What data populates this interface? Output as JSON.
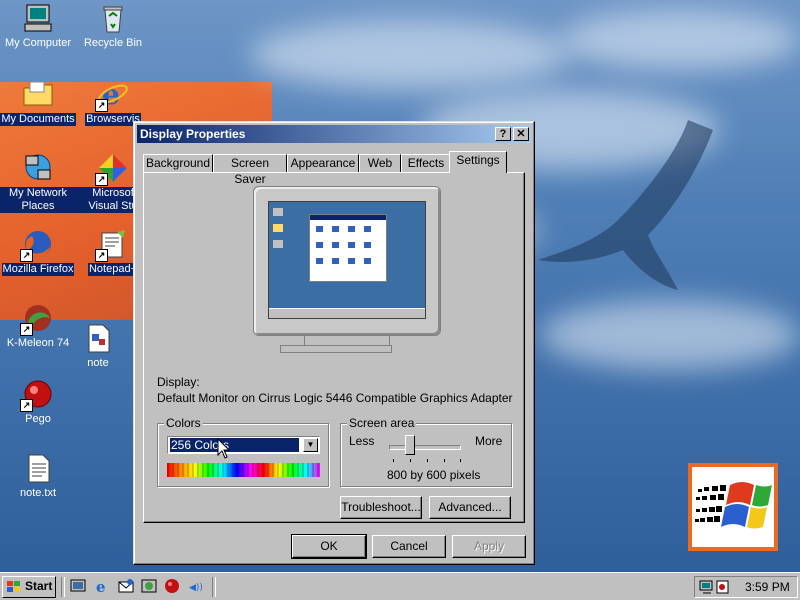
{
  "desktop": {
    "icons": [
      {
        "label": "My Computer",
        "icon": "my-computer-icon"
      },
      {
        "label": "Recycle Bin",
        "icon": "recycle-bin-icon"
      },
      {
        "label": "My Documents",
        "icon": "folder-icon"
      },
      {
        "label": "Browservis",
        "icon": "internet-explorer-icon"
      },
      {
        "label": "My Network Places",
        "icon": "network-icon"
      },
      {
        "label": "Microsof Visual Stu",
        "icon": "visual-studio-icon"
      },
      {
        "label": "Mozilla Firefox",
        "icon": "firefox-icon"
      },
      {
        "label": "Notepad+",
        "icon": "notepad-plus-icon"
      },
      {
        "label": "K-Meleon 74",
        "icon": "k-meleon-icon"
      },
      {
        "label": "note",
        "icon": "document-icon"
      },
      {
        "label": "Pego",
        "icon": "pego-icon"
      },
      {
        "label": "note.txt",
        "icon": "text-file-icon"
      }
    ]
  },
  "dialog": {
    "title": "Display Properties",
    "help_button": "?",
    "close_button": "✕",
    "tabs": [
      "Background",
      "Screen Saver",
      "Appearance",
      "Web",
      "Effects",
      "Settings"
    ],
    "active_tab": "Settings",
    "display_label": "Display:",
    "display_value": "Default Monitor on Cirrus Logic 5446 Compatible Graphics Adapter",
    "colors": {
      "label": "Colors",
      "selected": "256 Colors"
    },
    "screen_area": {
      "label": "Screen area",
      "less": "Less",
      "more": "More",
      "value": "800 by 600 pixels",
      "slider_level": 0.25
    },
    "troubleshoot_label": "Troubleshoot...",
    "advanced_label": "Advanced...",
    "ok_label": "OK",
    "cancel_label": "Cancel",
    "apply_label": "Apply"
  },
  "taskbar": {
    "start_label": "Start",
    "clock": "3:59 PM"
  },
  "colors": {
    "title_bar": "#0a246a",
    "desktop_blue": "#3c6ea6",
    "accent_orange": "#e96b22",
    "face": "#c0c0c0"
  }
}
